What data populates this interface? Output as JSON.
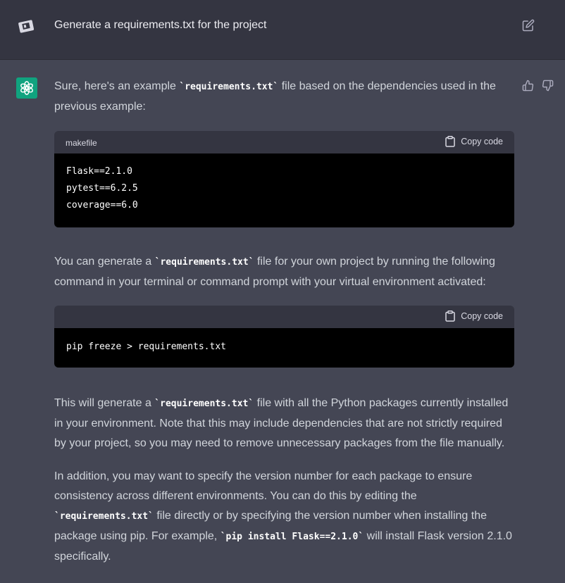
{
  "user": {
    "message": "Generate a requirements.txt for the project",
    "avatar_icon": "user-avatar-icon",
    "edit_icon": "edit-icon"
  },
  "assistant": {
    "intro_before": "Sure, here's an example ",
    "intro_code": "`requirements.txt`",
    "intro_after": " file based on the dependencies used in the previous example:",
    "code1": {
      "language": "makefile",
      "copy_label": "Copy code",
      "lines": [
        "Flask==2.1.0",
        "pytest==6.2.5",
        "coverage==6.0"
      ]
    },
    "p2_before": "You can generate a ",
    "p2_code": "`requirements.txt`",
    "p2_after": " file for your own project by running the following command in your terminal or command prompt with your virtual environment activated:",
    "code2": {
      "copy_label": "Copy code",
      "lines": [
        "pip freeze > requirements.txt"
      ]
    },
    "p3_before": "This will generate a ",
    "p3_code": "`requirements.txt`",
    "p3_after": " file with all the Python packages currently installed in your environment. Note that this may include dependencies that are not strictly required by your project, so you may need to remove unnecessary packages from the file manually.",
    "p4_part1": "In addition, you may want to specify the version number for each package to ensure consistency across different environments. You can do this by editing the ",
    "p4_code1": "`requirements.txt`",
    "p4_part2": " file directly or by specifying the version number when installing the package using pip. For example, ",
    "p4_code2": "`pip install Flask==2.1.0`",
    "p4_part3": " will install Flask version 2.1.0 specifically."
  },
  "colors": {
    "user_bg": "#343541",
    "assistant_bg": "#444654",
    "brand": "#10a37f",
    "code_bg": "#000000"
  }
}
